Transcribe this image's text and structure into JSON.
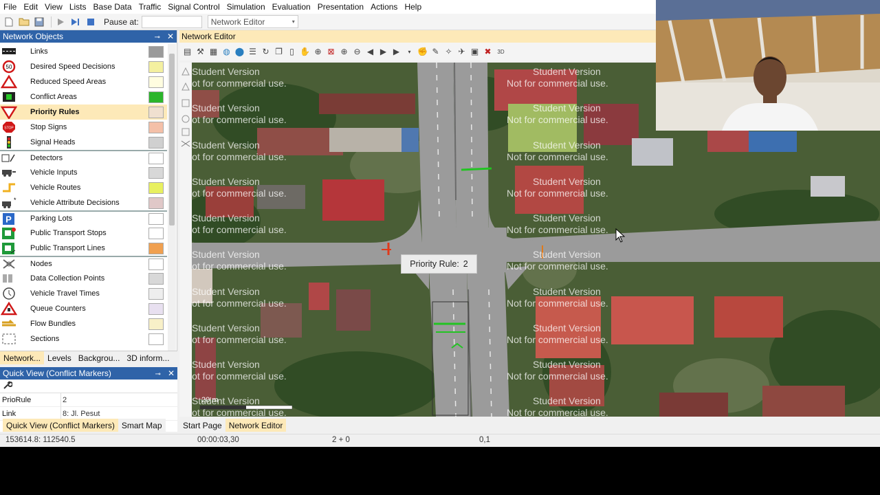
{
  "menu": [
    "File",
    "Edit",
    "View",
    "Lists",
    "Base Data",
    "Traffic",
    "Signal Control",
    "Simulation",
    "Evaluation",
    "Presentation",
    "Actions",
    "Help"
  ],
  "toolbar": {
    "pause_label": "Pause at:",
    "pause_value": "",
    "view_select": "Network Editor"
  },
  "network_objects": {
    "title": "Network Objects",
    "items": [
      {
        "label": "Links",
        "icon": "links-icon",
        "swatch": "#9a9a9a"
      },
      {
        "label": "Desired Speed Decisions",
        "icon": "speed-50-icon",
        "swatch": "#f4f0a0"
      },
      {
        "label": "Reduced Speed Areas",
        "icon": "warning-triangle-icon",
        "swatch": "#fffde0"
      },
      {
        "label": "Conflict Areas",
        "icon": "conflict-area-icon",
        "swatch": "#2bb52b"
      },
      {
        "label": "Priority Rules",
        "icon": "yield-icon",
        "swatch": "#f0e0d0"
      },
      {
        "label": "Stop Signs",
        "icon": "stop-sign-icon",
        "swatch": "#f4c0a8"
      },
      {
        "label": "Signal Heads",
        "icon": "traffic-light-icon",
        "swatch": "#d0d0d0"
      },
      {
        "label": "Detectors",
        "icon": "detector-icon",
        "swatch": "#ffffff"
      },
      {
        "label": "Vehicle Inputs",
        "icon": "vehicle-input-icon",
        "swatch": "#d8d8d8"
      },
      {
        "label": "Vehicle Routes",
        "icon": "vehicle-route-icon",
        "swatch": "#e8f060"
      },
      {
        "label": "Vehicle Attribute Decisions",
        "icon": "vehicle-attribute-icon",
        "swatch": "#e0c8c8"
      },
      {
        "label": "Parking Lots",
        "icon": "parking-icon",
        "swatch": "#ffffff"
      },
      {
        "label": "Public Transport Stops",
        "icon": "pt-stop-icon",
        "swatch": "#ffffff"
      },
      {
        "label": "Public Transport Lines",
        "icon": "pt-line-icon",
        "swatch": "#f0a050"
      },
      {
        "label": "Nodes",
        "icon": "nodes-icon",
        "swatch": "#ffffff"
      },
      {
        "label": "Data Collection Points",
        "icon": "data-collection-icon",
        "swatch": "#d8d8d8"
      },
      {
        "label": "Vehicle Travel Times",
        "icon": "travel-time-icon",
        "swatch": "#eeeeee"
      },
      {
        "label": "Queue Counters",
        "icon": "queue-counter-icon",
        "swatch": "#e8e0f0"
      },
      {
        "label": "Flow Bundles",
        "icon": "flow-bundle-icon",
        "swatch": "#f8f0c8"
      },
      {
        "label": "Sections",
        "icon": "sections-icon",
        "swatch": "#ffffff"
      }
    ],
    "tabs": [
      "Network...",
      "Levels",
      "Backgrou...",
      "3D inform..."
    ]
  },
  "quick_view": {
    "title": "Quick View (Conflict Markers)",
    "rows": [
      {
        "key": "PrioRule",
        "value": "2"
      },
      {
        "key": "Link",
        "value": "8: Jl. Pesut"
      }
    ],
    "tabs": [
      "Quick View (Conflict Markers)",
      "Smart Map"
    ]
  },
  "editor": {
    "title": "Network Editor",
    "tooltip_label": "Priority Rule:",
    "tooltip_value": "2",
    "watermark_line1": "Student Version",
    "watermark_line2": "Not for commercial use.",
    "scale_label": "20 m",
    "tabs": [
      "Start Page",
      "Network Editor"
    ]
  },
  "status": {
    "coords": "153614.8: 112540.5",
    "sim_time": "00:00:03,30",
    "vehicles": "2 + 0",
    "speed": "0,1"
  },
  "colors": {
    "panel_title": "#2f63a8",
    "selected_bg": "#fde9b8",
    "road": "#9b9b9b",
    "priority_marker": "#22c422",
    "stop_marker": "#e03a1a"
  }
}
